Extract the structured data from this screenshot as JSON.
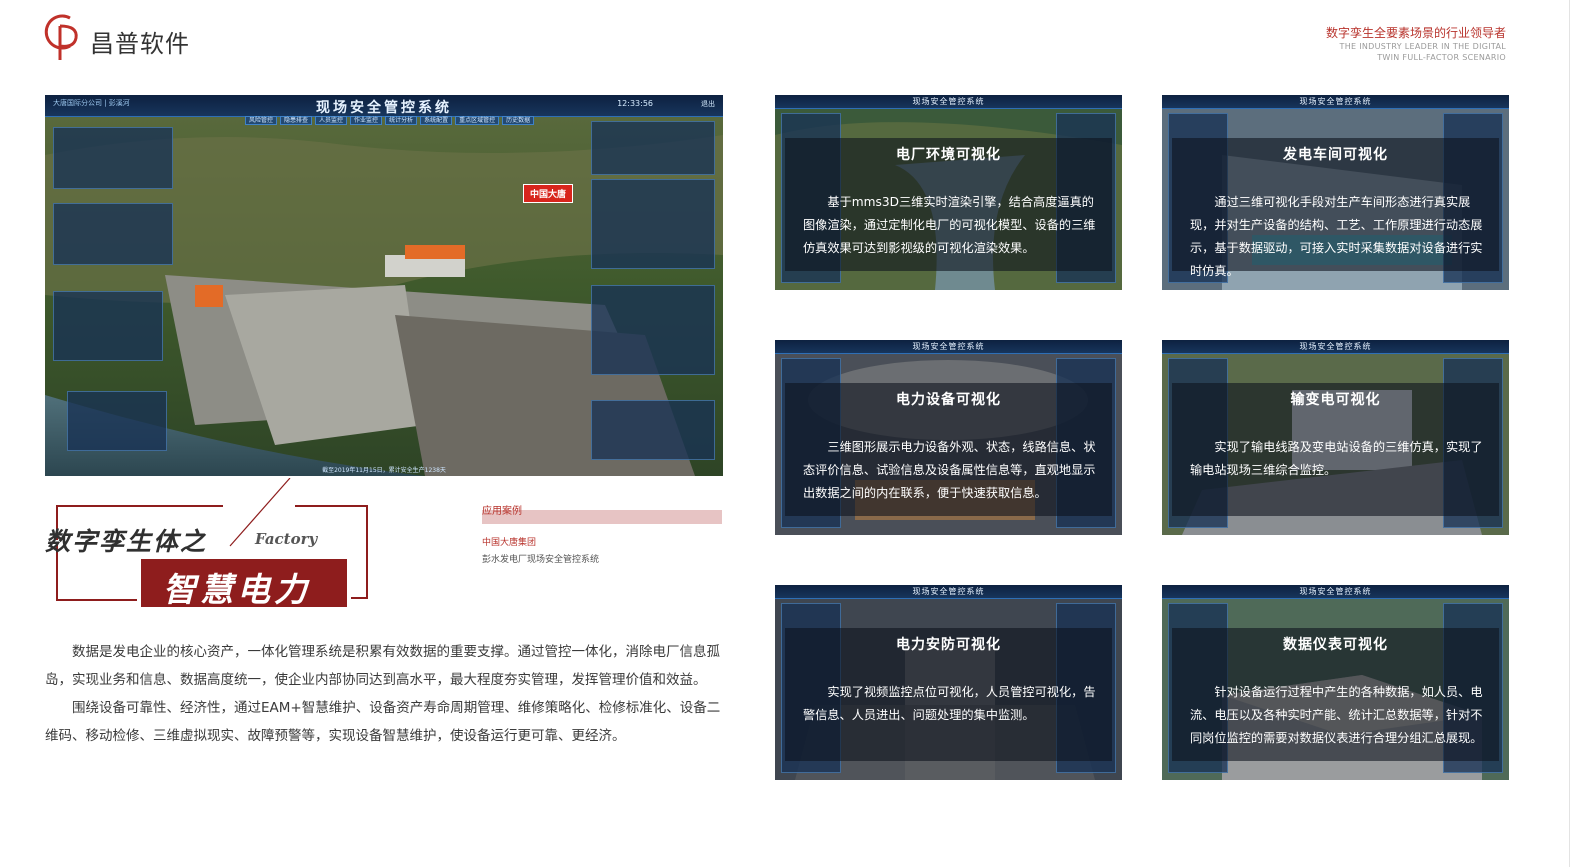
{
  "header": {
    "brand": "昌普软件",
    "tagline_cn": "数字孪生全要素场景的行业领导者",
    "tagline_en_line1": "THE INDUSTRY LEADER IN THE DIGITAL",
    "tagline_en_line2": "TWIN FULL-FACTOR SCENARIO"
  },
  "main_screenshot": {
    "system_title": "现场安全管控系统",
    "top_left": "大唐国际分公司 | 彭溪河",
    "clock": "12:33:56",
    "exit": "退出",
    "menu": [
      "风险管控",
      "隐患排查",
      "人员监控",
      "作业监控",
      "统计分析",
      "系统配置",
      "重点区域管控",
      "历史数据"
    ],
    "brand_sign": "中国大唐",
    "footer": "截至2019年11月15日，累计安全生产1238天"
  },
  "title_block": {
    "heading": "数字孪生体之",
    "english": "Factory",
    "subtitle": "智慧电力"
  },
  "case": {
    "label": "应用案例",
    "company": "中国大唐集团",
    "system": "彭水发电厂现场安全管控系统"
  },
  "body": {
    "paragraph1": "数据是发电企业的核心资产，一体化管理系统是积累有效数据的重要支撑。通过管控一体化，消除电厂信息孤岛，实现业务和信息、数据高度统一，使企业内部协同达到高水平，最大程度夯实管理，发挥管理价值和效益。",
    "paragraph2": "围绕设备可靠性、经济性，通过EAM+智慧维护、设备资产寿命周期管理、维修策略化、检修标准化、设备二维码、移动检修、三维虚拟现实、故障预警等，实现设备智慧维护，使设备运行更可靠、更经济。"
  },
  "thumbnails": [
    {
      "title": "电厂环境可视化",
      "system_title": "现场安全管控系统",
      "desc": "基于mms3D三维实时渲染引擎，结合高度逼真的图像渲染，通过定制化电厂的可视化模型、设备的三维仿真效果可达到影视级的可视化渲染效果。"
    },
    {
      "title": "发电车间可视化",
      "system_title": "现场安全管控系统",
      "desc": "通过三维可视化手段对生产车间形态进行真实展现，并对生产设备的结构、工艺、工作原理进行动态展示，基于数据驱动，可接入实时采集数据对设备进行实时仿真。"
    },
    {
      "title": "电力设备可视化",
      "system_title": "现场安全管控系统",
      "desc": "三维图形展示电力设备外观、状态，线路信息、状态评价信息、试验信息及设备属性信息等，直观地显示出数据之间的内在联系，便于快速获取信息。"
    },
    {
      "title": "输变电可视化",
      "system_title": "现场安全管控系统",
      "desc": "实现了输电线路及变电站设备的三维仿真，实现了输电站现场三维综合监控。"
    },
    {
      "title": "电力安防可视化",
      "system_title": "现场安全管控系统",
      "desc": "实现了视频监控点位可视化，人员管控可视化，告警信息、人员进出、问题处理的集中监测。"
    },
    {
      "title": "数据仪表可视化",
      "system_title": "现场安全管控系统",
      "desc": "针对设备运行过程中产生的各种数据，如人员、电流、电压以及各种实时产能、统计汇总数据等，针对不同岗位监控的需要对数据仪表进行合理分组汇总展现。"
    }
  ],
  "colors": {
    "brand_red": "#b8332c",
    "dark_red": "#8e1d1d",
    "screen_blue": "#1c3147"
  }
}
